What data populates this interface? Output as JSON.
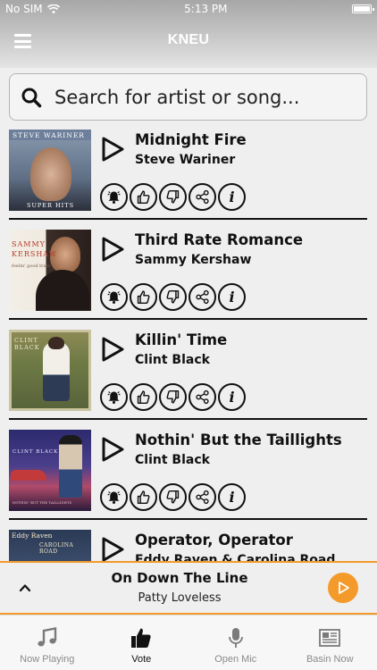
{
  "status": {
    "carrier": "No SIM",
    "time": "5:13 PM"
  },
  "header": {
    "title": "KNEU"
  },
  "search": {
    "placeholder": "Search for artist or song..."
  },
  "songs": [
    {
      "title": "Midnight Fire",
      "artist": "Steve Wariner",
      "cover_text": [
        "STEVE WARINER",
        "SUPER HITS"
      ]
    },
    {
      "title": "Third Rate Romance",
      "artist": "Sammy Kershaw",
      "cover_text": [
        "SAMMY",
        "KERSHAW",
        "feelin' good train"
      ]
    },
    {
      "title": "Killin' Time",
      "artist": "Clint Black",
      "cover_text": [
        "CLINT",
        "BLACK"
      ]
    },
    {
      "title": "Nothin' But the Taillights",
      "artist": "Clint Black",
      "cover_text": [
        "CLINT BLACK",
        "NOTHIN' BUT THE TAILLIGHTS"
      ]
    },
    {
      "title": "Operator, Operator",
      "artist": "Eddy Raven & Carolina Road",
      "cover_text": [
        "Eddy Raven",
        "CAROLINA ROAD"
      ]
    }
  ],
  "now_playing": {
    "title": "On Down The Line",
    "artist": "Patty Loveless"
  },
  "tabs": [
    {
      "label": "Now Playing",
      "icon": "music-note-icon"
    },
    {
      "label": "Vote",
      "icon": "thumbs-up-icon"
    },
    {
      "label": "Open Mic",
      "icon": "microphone-icon"
    },
    {
      "label": "Basin Now",
      "icon": "newspaper-icon"
    }
  ],
  "colors": {
    "accent": "#f39a2b",
    "text": "#111111",
    "background": "#efefef"
  }
}
